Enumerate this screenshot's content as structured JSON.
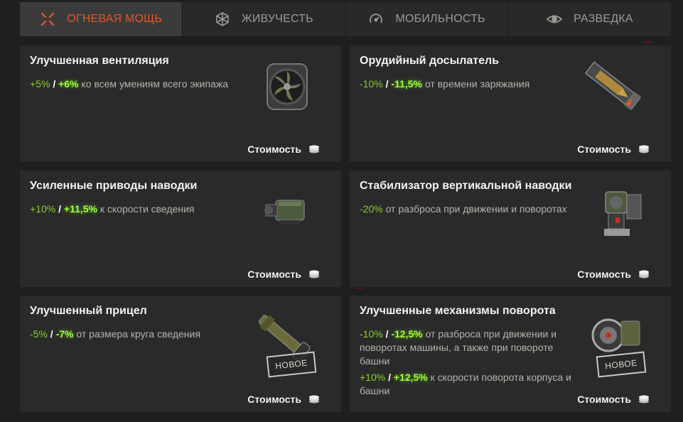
{
  "tabs": [
    {
      "label": "Огневая мощь",
      "icon": "crosshair-icon",
      "active": true
    },
    {
      "label": "Живучесть",
      "icon": "armor-icon",
      "active": false
    },
    {
      "label": "Мобильность",
      "icon": "speedometer-icon",
      "active": false
    },
    {
      "label": "Разведка",
      "icon": "eye-icon",
      "active": false
    }
  ],
  "cost_label": "Стоимость",
  "cost_icon": "silver-coins-icon",
  "cards": [
    {
      "title": "Улучшенная вентиляция",
      "lines": [
        {
          "v1": "+5%",
          "sep": "/",
          "v2": "+6%",
          "text": "ко всем умениям всего экипажа"
        }
      ],
      "image": "ventilation-icon"
    },
    {
      "title": "Орудийный досылатель",
      "lines": [
        {
          "v1": "-10%",
          "sep": "/",
          "v2": "-11,5%",
          "text": "от времени заряжания"
        }
      ],
      "image": "rammer-icon"
    },
    {
      "title": "Усиленные приводы наводки",
      "lines": [
        {
          "v1": "+10%",
          "sep": "/",
          "v2": "+11,5%",
          "text": "к скорости сведения"
        }
      ],
      "image": "gun-drive-icon"
    },
    {
      "title": "Стабилизатор вертикальной наводки",
      "lines": [
        {
          "v1": "-20%",
          "sep": "",
          "v2": "",
          "text": "от разброса при движении и поворотах"
        }
      ],
      "image": "stabilizer-icon"
    },
    {
      "title": "Улучшенный прицел",
      "lines": [
        {
          "v1": "-5%",
          "sep": "/",
          "v2": "-7%",
          "text": "от размера круга сведения"
        }
      ],
      "image": "gunsight-icon",
      "badge": "Новое"
    },
    {
      "title": "Улучшенные механизмы поворота",
      "lines": [
        {
          "v1": "-10%",
          "sep": "/",
          "v2": "-12,5%",
          "text": "от разброса при движении и поворотах машины, а также при повороте башни"
        },
        {
          "v1": "+10%",
          "sep": "/",
          "v2": "+12,5%",
          "text": "к скорости поворота корпуса и башни"
        }
      ],
      "image": "turning-mechanism-icon",
      "badge": "Новое"
    }
  ],
  "colors": {
    "accent": "#e2542a",
    "bonus": "#8ccf2e",
    "bonus_bright": "#a0ff3a",
    "card_bg": "#2a2a2a",
    "page_bg": "#1f1f1f"
  }
}
